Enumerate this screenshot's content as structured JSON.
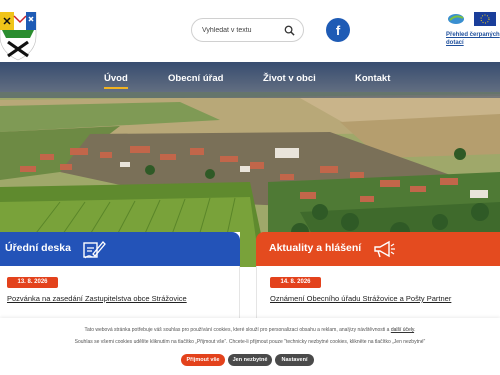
{
  "header": {
    "search": {
      "placeholder": "Vyhledat v textu"
    },
    "eu_link": "Přehled čerpaných dotací"
  },
  "nav": {
    "items": [
      {
        "label": "Úvod",
        "active": true
      },
      {
        "label": "Obecní úřad",
        "active": false
      },
      {
        "label": "Život v obci",
        "active": false
      },
      {
        "label": "Kontakt",
        "active": false
      }
    ],
    "active_color": "#f2b321"
  },
  "panels": {
    "official_board": {
      "title": "Úřední deska",
      "icon": "signature-icon",
      "color": "#2353b8",
      "date": "13. 8. 2026",
      "link": "Pozvánka na zasedání Zastupitelstva obce Strážovice"
    },
    "news": {
      "title": "Aktuality a hlášení",
      "icon": "megaphone-icon",
      "color": "#e44b1f",
      "date": "14. 8. 2026",
      "link": "Oznámení Obecního úřadu Strážovice a Pošty Partner"
    }
  },
  "cookie": {
    "line1": "Tato webová stránka potřebuje váš souhlas pro používání cookies, které slouží pro personalizaci obsahu a reklam, analýzy návštěvnosti a ",
    "line1_link": "další účely",
    "line1_end": ".",
    "line2": "Souhlas se všemi cookies udělíte kliknutím na tlačítko „Přijmout vše“. Chcete-li přijmout pouze \"technicky nezbytné cookies, klikněte na tlačítko „Jen nezbytné\"",
    "accept": "Přijmout vše",
    "necessary": "Jen nezbytné",
    "settings": "Nastavení",
    "accent": "#e3421c"
  }
}
